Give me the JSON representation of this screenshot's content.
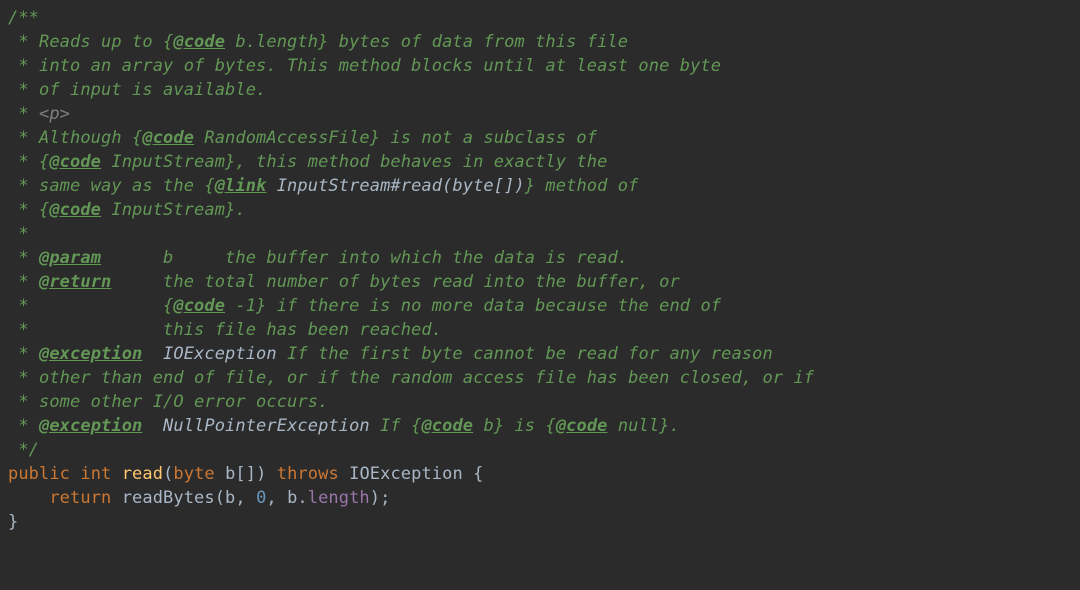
{
  "doc": {
    "open": "/**",
    "l1a": " * Reads up to {",
    "tag_code": "@code",
    "l1b": " b.length} bytes of data from this file",
    "l2": " * into an array of bytes. This method blocks until at least one byte",
    "l3": " * of input is available.",
    "star": " * ",
    "p_tag": "<p>",
    "l5a": " * Although {",
    "l5b": " RandomAccessFile} is not a subclass of",
    "l6a": " * {",
    "l6b": " InputStream}, this method behaves in exactly the",
    "l7a": " * same way as the {",
    "tag_link": "@link",
    "l7link": " InputStream#read(byte[])",
    "l7b": "} method of",
    "l8a": " * {",
    "l8b": " InputStream}.",
    "empty": " *",
    "tag_param": "@param",
    "param_line": "      b     the buffer into which the data is read.",
    "tag_return": "@return",
    "ret_l1": "     the total number of bytes read into the buffer, or",
    "ret_l2a": " *             {",
    "ret_l2b": " -1} if there is no more data because the end of",
    "ret_l3": " *             this file has been reached.",
    "tag_exception": "@exception",
    "exc1_name": "  IOException",
    "exc1_rest": " If the first byte cannot be read for any reason",
    "exc_l2": " * other than end of file, or if the random access file has been closed, or if",
    "exc_l3": " * some other I/O error occurs.",
    "exc2_name": "  NullPointerException",
    "exc2_rest1": " If {",
    "exc2_rest2": " b} is {",
    "exc2_rest3": " null}.",
    "close": " */"
  },
  "code": {
    "kw_public": "public",
    "kw_int": "int",
    "fn_read": "read",
    "sig_open": "(",
    "kw_byte": "byte",
    "param_b": " b",
    "brackets": "[]",
    "sig_close": ") ",
    "kw_throws": "throws",
    "type_ioe": " IOException ",
    "brace_open": "{",
    "indent": "    ",
    "kw_return": "return",
    "call_readBytes": " readBytes(b",
    "comma": ", ",
    "zero": "0",
    "comma2": ", ",
    "b_dot": "b.",
    "length": "length",
    "call_close": ");",
    "brace_close": "}"
  }
}
